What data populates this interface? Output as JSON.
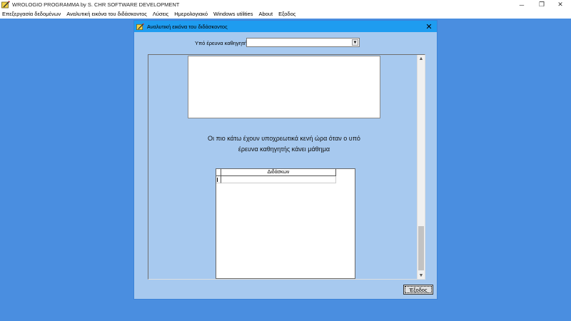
{
  "app": {
    "title": "WROLOGIO PROGRAMMA by S. CHR SOFTWARE DEVELOPMENT",
    "controls": {
      "minimize": "─",
      "restore": "❐",
      "close": "✕"
    }
  },
  "menu": [
    {
      "label": "Επεξεργασία δεδομένων"
    },
    {
      "label": "Αναλυτική εικόνα του διδάσκοντος"
    },
    {
      "label": "Λύσεις"
    },
    {
      "label": "Ημερολογιακό"
    },
    {
      "label": "Windows utilities"
    },
    {
      "label": "About"
    },
    {
      "label": "Εξοδος"
    }
  ],
  "dialog": {
    "title": "Αναλυτική εικόνα του διδάσκοντος",
    "close_glyph": "✕",
    "teacher_label": "Υπό έρευνα καθηγητής:",
    "teacher_value": "",
    "message_line1": "Οι πιο κάτω έχουν υποχρεωτικά κενή ώρα όταν ο υπό",
    "message_line2": "έρευνα καθηγητής κάνει μάθημα",
    "grid_header": "Διδάσκων",
    "exit_label": "Έξοδος",
    "scroll_up_glyph": "▲",
    "scroll_down_glyph": "▼",
    "dropdown_glyph": "▼"
  },
  "colors": {
    "desktop": "#4a8ee0",
    "dialog_bg": "#a7c9ef",
    "dialog_titlebar": "#1e9cf0"
  }
}
